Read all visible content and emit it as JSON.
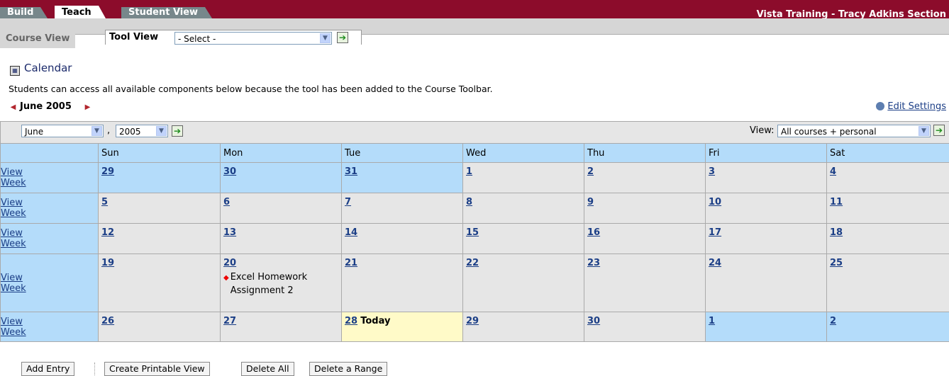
{
  "header": {
    "tabs": [
      "Build",
      "Teach",
      "Student View"
    ],
    "active_tab": "Teach",
    "section_name": "Vista Training - Tracy Adkins Section"
  },
  "subnav": {
    "course_view": "Course View",
    "tool_view": "Tool View",
    "tool_select_value": "- Select -"
  },
  "page": {
    "title": "Calendar",
    "info": "Students can access all available components below because the tool has been added to the Course Toolbar.",
    "month_title": "June 2005",
    "edit_settings": "Edit Settings"
  },
  "calendar_controls": {
    "month_value": "June",
    "comma": ",",
    "year_value": "2005",
    "view_label": "View:",
    "view_value": "All courses + personal"
  },
  "calendar": {
    "headers": [
      "Sun",
      "Mon",
      "Tue",
      "Wed",
      "Thu",
      "Fri",
      "Sat"
    ],
    "view_week": [
      "View",
      "Week"
    ],
    "weeks": [
      [
        {
          "num": "29",
          "style": "blue"
        },
        {
          "num": "30",
          "style": "blue"
        },
        {
          "num": "31",
          "style": "blue"
        },
        {
          "num": "1",
          "style": "grey"
        },
        {
          "num": "2",
          "style": "grey"
        },
        {
          "num": "3",
          "style": "grey"
        },
        {
          "num": "4",
          "style": "grey"
        }
      ],
      [
        {
          "num": "5",
          "style": "grey"
        },
        {
          "num": "6",
          "style": "grey"
        },
        {
          "num": "7",
          "style": "grey"
        },
        {
          "num": "8",
          "style": "grey"
        },
        {
          "num": "9",
          "style": "grey"
        },
        {
          "num": "10",
          "style": "grey"
        },
        {
          "num": "11",
          "style": "grey"
        }
      ],
      [
        {
          "num": "12",
          "style": "grey"
        },
        {
          "num": "13",
          "style": "grey"
        },
        {
          "num": "14",
          "style": "grey"
        },
        {
          "num": "15",
          "style": "grey"
        },
        {
          "num": "16",
          "style": "grey"
        },
        {
          "num": "17",
          "style": "grey"
        },
        {
          "num": "18",
          "style": "grey"
        }
      ],
      [
        {
          "num": "19",
          "style": "grey"
        },
        {
          "num": "20",
          "style": "grey",
          "event": "Excel Homework Assignment 2"
        },
        {
          "num": "21",
          "style": "grey"
        },
        {
          "num": "22",
          "style": "grey"
        },
        {
          "num": "23",
          "style": "grey"
        },
        {
          "num": "24",
          "style": "grey"
        },
        {
          "num": "25",
          "style": "grey"
        }
      ],
      [
        {
          "num": "26",
          "style": "grey"
        },
        {
          "num": "27",
          "style": "grey"
        },
        {
          "num": "28",
          "style": "today",
          "label": "Today"
        },
        {
          "num": "29",
          "style": "grey"
        },
        {
          "num": "30",
          "style": "grey"
        },
        {
          "num": "1",
          "style": "blue"
        },
        {
          "num": "2",
          "style": "blue"
        }
      ]
    ]
  },
  "buttons": {
    "add_entry": "Add Entry",
    "printable": "Create Printable View",
    "delete_all": "Delete All",
    "delete_range": "Delete a Range"
  },
  "colors": {
    "header_bar": "#8c0c2b",
    "calendar_blue": "#b4dcfa",
    "today": "#fffac8",
    "link": "#1b3e86"
  }
}
